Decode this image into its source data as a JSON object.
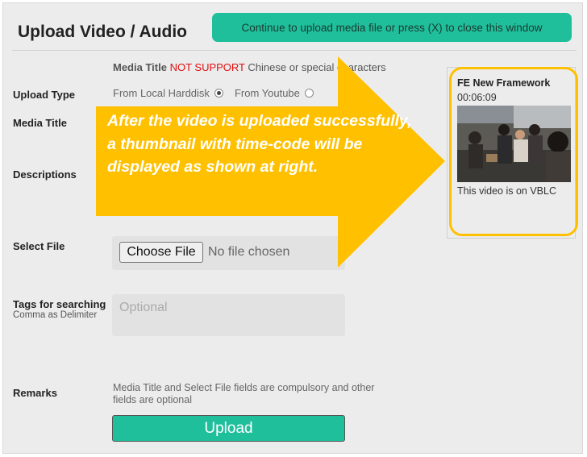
{
  "form": {
    "title": "Upload Video / Audio",
    "banner": "Continue to upload media file or press (X) to close this window",
    "note_bold": "Media Title",
    "note_red": "NOT SUPPORT",
    "note_rest": "Chinese or special characters",
    "labels": {
      "upload_type": "Upload Type",
      "media_title": "Media Title",
      "descriptions": "Descriptions",
      "select_file": "Select File",
      "tags": "Tags for searching",
      "tags_sub": "Comma as Delimiter",
      "remarks": "Remarks"
    },
    "upload_type_options": [
      "From Local Harddisk",
      "From Youtube"
    ],
    "upload_type_selected": "From Local Harddisk",
    "file_button": "Choose File",
    "file_status": "No file chosen",
    "tags_placeholder": "Optional",
    "remarks_text": "Media Title and Select File fields are compulsory and other fields are optional",
    "upload_button": "Upload"
  },
  "callout": {
    "text": "After the video is uploaded successfully, a thumbnail with time-code will be displayed as shown at right.",
    "color": "#ffc000"
  },
  "preview": {
    "title": "FE New Framework",
    "timecode": "00:06:09",
    "caption": "This video is on VBLC"
  },
  "colors": {
    "accent": "#1fbf9c",
    "callout": "#ffc000",
    "warning": "#e01010"
  }
}
